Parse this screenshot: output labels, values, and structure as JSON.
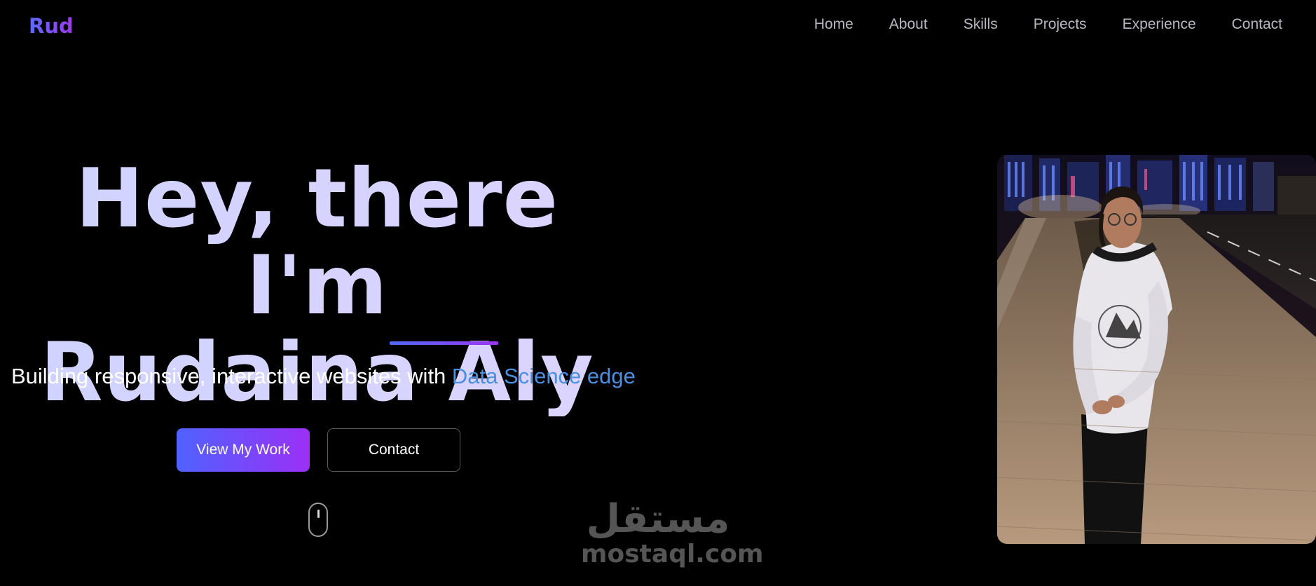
{
  "header": {
    "logo": "Rud",
    "nav": [
      "Home",
      "About",
      "Skills",
      "Projects",
      "Experience",
      "Contact"
    ]
  },
  "hero": {
    "title_line1": "Hey, there I'm",
    "title_line2": "Rudaina Aly",
    "subtitle_prefix": "Building responsive, interactive websites with ",
    "subtitle_accent": "Data Science edge",
    "primary_button": "View My Work",
    "secondary_button": "Contact"
  },
  "watermark": {
    "arabic": "مستقل",
    "latin": "mostaql.com"
  },
  "colors": {
    "background": "#000000",
    "accent_blue": "#4a90e2",
    "gradient_start": "#4f62ff",
    "gradient_end": "#9b30f5",
    "title": "#d4d5ff"
  },
  "icons": {
    "scroll": "mouse-scroll-icon"
  }
}
